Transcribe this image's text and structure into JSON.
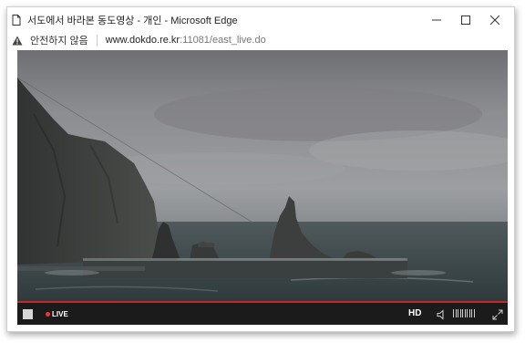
{
  "window": {
    "title": "서도에서 바라본 동도영상 - 개인 - Microsoft Edge",
    "minimize_icon": "minimize-icon",
    "maximize_icon": "maximize-icon",
    "close_icon": "close-icon"
  },
  "address": {
    "security_label": "안전하지 않음",
    "url_host": "www.dokdo.re.kr",
    "url_rest": ":11081/east_live.do"
  },
  "player": {
    "live_label": "LIVE",
    "hd_label": "HD",
    "volume_icon": "speaker-icon",
    "fullscreen_icon": "fullscreen-icon",
    "progress_color": "#c62828",
    "live_dot_color": "#e53935"
  }
}
